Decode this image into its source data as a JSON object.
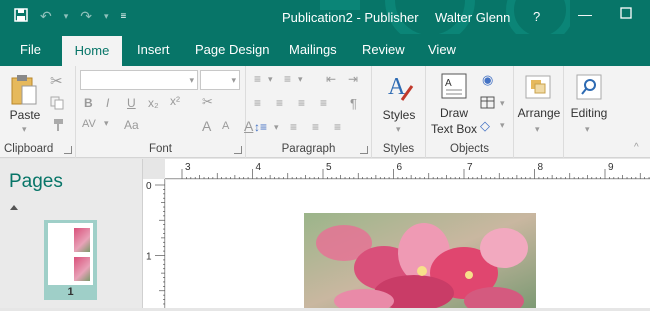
{
  "window": {
    "title": "Publication2  -  Publisher",
    "user": "Walter Glenn",
    "help": "?",
    "qat": {
      "save_icon": "save-icon",
      "undo_icon": "undo-icon",
      "redo_icon": "redo-icon",
      "customize_icon": "customize-qat-icon"
    }
  },
  "tabs": [
    "File",
    "Home",
    "Insert",
    "Page Design",
    "Mailings",
    "Review",
    "View"
  ],
  "active_tab": "Home",
  "ribbon": {
    "clipboard": {
      "paste": "Paste",
      "group": "Clipboard"
    },
    "font": {
      "group": "Font",
      "bold": "B",
      "italic": "I",
      "underline": "U",
      "subscript": "x₂",
      "superscript": "x²",
      "spacing": "AV",
      "grow": "A",
      "shrink": "A",
      "color": "A"
    },
    "paragraph": {
      "group": "Paragraph",
      "pilcrow": "¶"
    },
    "styles": {
      "label": "Styles",
      "group": "Styles"
    },
    "objects": {
      "draw1": "Draw",
      "draw2": "Text Box",
      "group": "Objects"
    },
    "arrange": {
      "label": "Arrange"
    },
    "editing": {
      "label": "Editing"
    }
  },
  "pages_pane": {
    "title": "Pages",
    "page_number": "1"
  },
  "ruler": {
    "h_labels": [
      "3",
      "4",
      "5",
      "6",
      "7",
      "8",
      "9"
    ],
    "v_labels": [
      "0",
      "1"
    ]
  },
  "colors": {
    "accent": "#077568",
    "tab_active_text": "#077568"
  }
}
